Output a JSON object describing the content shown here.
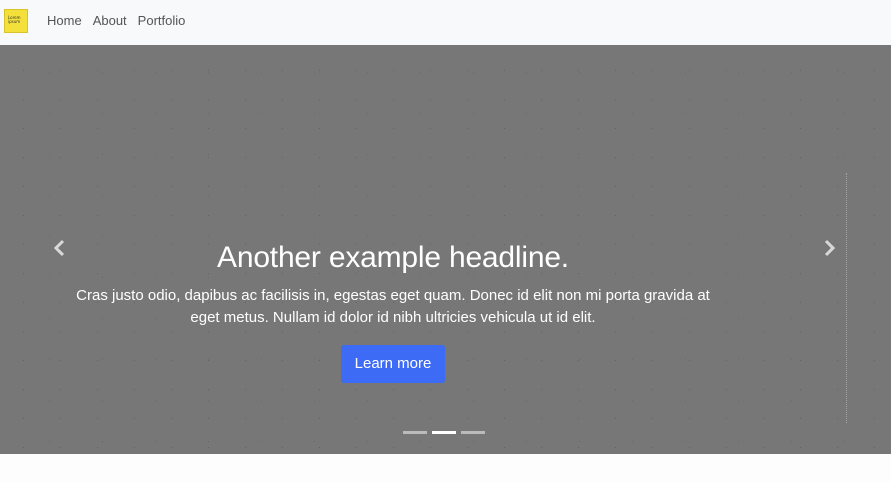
{
  "navbar": {
    "logo_text": "Lorem ipsum",
    "links": [
      {
        "label": "Home"
      },
      {
        "label": "About"
      },
      {
        "label": "Portfolio"
      }
    ]
  },
  "carousel": {
    "headline": "Another example headline.",
    "text": "Cras justo odio, dapibus ac facilisis in, egestas eget quam. Donec id elit non mi porta gravida at eget metus. Nullam id dolor id nibh ultricies vehicula ut id elit.",
    "button_label": "Learn more",
    "prev_icon": "chevron-left-icon",
    "next_icon": "chevron-right-icon",
    "slide_count": 3,
    "active_slide": 2,
    "colors": {
      "background": "#777777",
      "button": "#3d6bf5",
      "logo": "#f3e03a"
    }
  }
}
